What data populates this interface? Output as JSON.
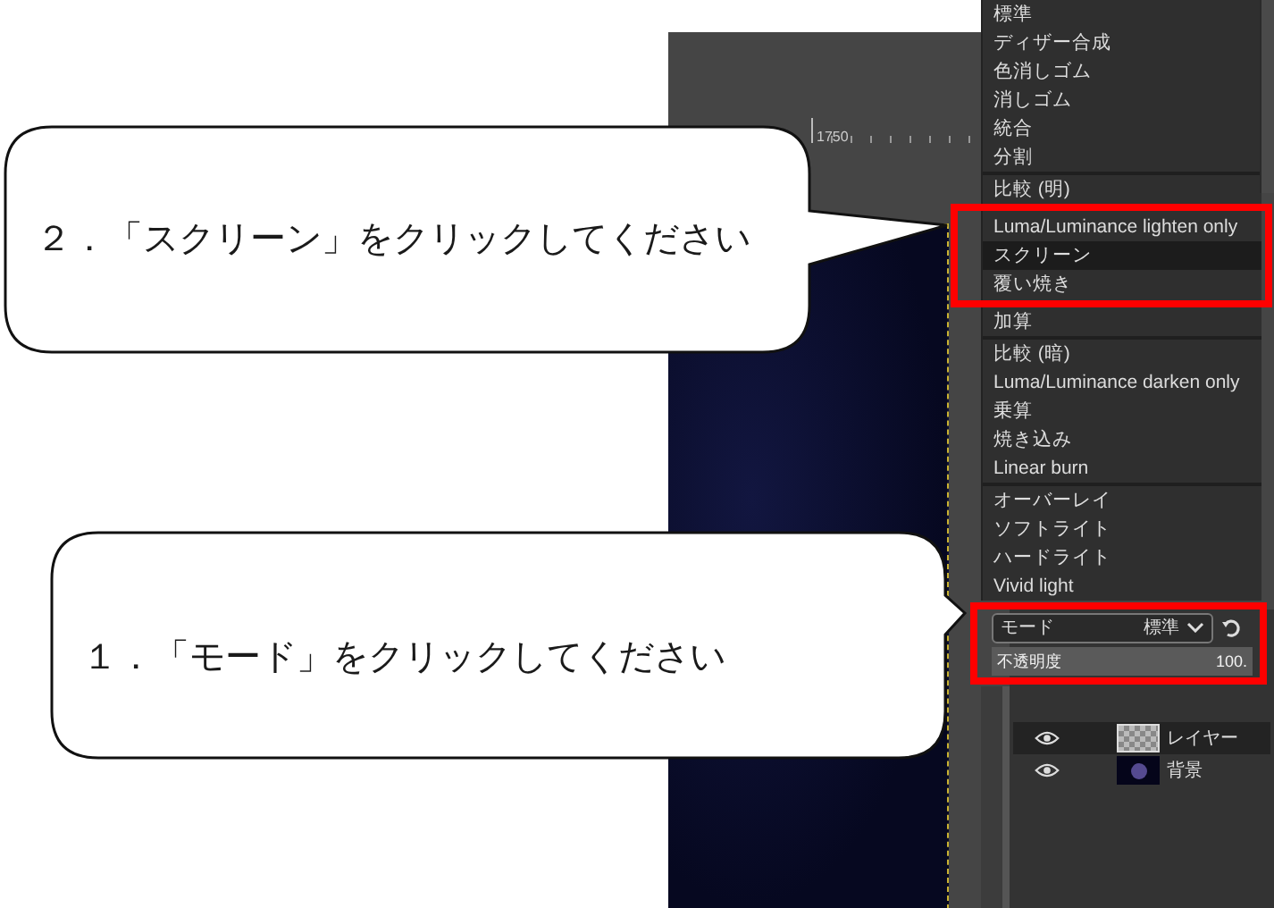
{
  "ruler": {
    "label": "1750"
  },
  "mode_menu": {
    "groups": [
      {
        "items": [
          {
            "label": "標準",
            "selected": false
          },
          {
            "label": "ディザー合成",
            "selected": false
          },
          {
            "label": "色消しゴム",
            "selected": false
          },
          {
            "label": "消しゴム",
            "selected": false
          },
          {
            "label": "統合",
            "selected": false
          },
          {
            "label": "分割",
            "selected": false
          }
        ]
      },
      {
        "items": [
          {
            "label": "比較 (明)",
            "selected": false
          },
          {
            "label": "Luma/Luminance lighten only",
            "selected": false
          },
          {
            "label": "スクリーン",
            "selected": true
          },
          {
            "label": "覆い焼き",
            "selected": false
          },
          {
            "label": "加算",
            "selected": false
          }
        ]
      },
      {
        "items": [
          {
            "label": "比較 (暗)",
            "selected": false
          },
          {
            "label": "Luma/Luminance darken only",
            "selected": false
          },
          {
            "label": "乗算",
            "selected": false
          },
          {
            "label": "焼き込み",
            "selected": false
          },
          {
            "label": "Linear burn",
            "selected": false
          }
        ]
      },
      {
        "items": [
          {
            "label": "オーバーレイ",
            "selected": false
          },
          {
            "label": "ソフトライト",
            "selected": false
          },
          {
            "label": "ハードライト",
            "selected": false
          },
          {
            "label": "Vivid light",
            "selected": false
          }
        ]
      }
    ]
  },
  "layers_panel": {
    "mode": {
      "label": "モード",
      "value": "標準"
    },
    "opacity": {
      "label": "不透明度",
      "value": "100."
    },
    "layers": [
      {
        "name": "レイヤー",
        "kind": "transparent",
        "selected": true,
        "visible": true
      },
      {
        "name": "背景",
        "kind": "image",
        "selected": false,
        "visible": true
      }
    ]
  },
  "callouts": [
    {
      "text": "２．「スクリーン」をクリックしてください"
    },
    {
      "text": "１．「モード」をクリックしてください"
    }
  ]
}
